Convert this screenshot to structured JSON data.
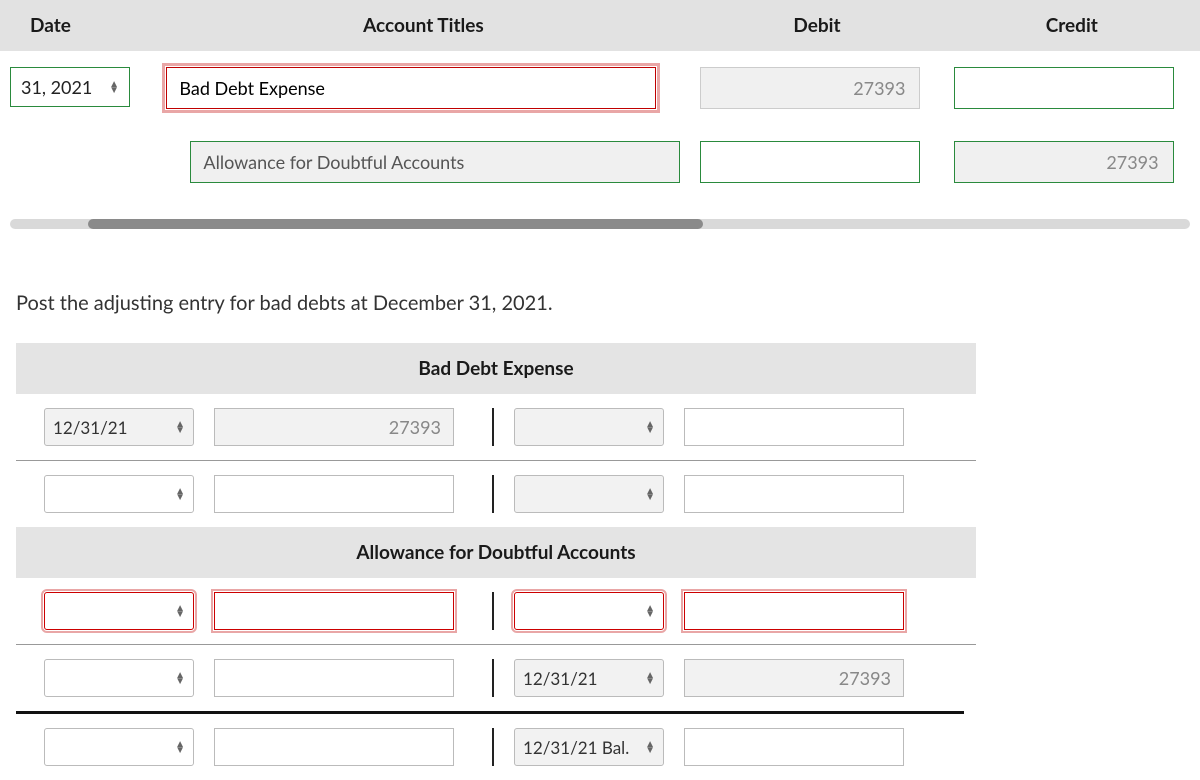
{
  "journal": {
    "headers": {
      "date": "Date",
      "titles": "Account Titles",
      "debit": "Debit",
      "credit": "Credit"
    },
    "rows": [
      {
        "date": "31, 2021",
        "account": "Bad Debt Expense",
        "debit": "27393",
        "credit": ""
      },
      {
        "date": "",
        "account": "Allowance for Doubtful Accounts",
        "debit": "",
        "credit": "27393"
      }
    ]
  },
  "instruction": "Post the adjusting entry for bad debts at December 31, 2021.",
  "taccounts": [
    {
      "title": "Bad Debt Expense",
      "rows": [
        {
          "left_date": "12/31/21",
          "left_amount": "27393",
          "right_date": "",
          "right_amount": ""
        },
        {
          "left_date": "",
          "left_amount": "",
          "right_date": "",
          "right_amount": ""
        }
      ]
    },
    {
      "title": "Allowance for Doubtful Accounts",
      "rows": [
        {
          "left_date": "",
          "left_amount": "",
          "right_date": "",
          "right_amount": "",
          "highlight": true
        },
        {
          "left_date": "",
          "left_amount": "",
          "right_date": "12/31/21",
          "right_amount": "27393"
        },
        {
          "left_date": "",
          "left_amount": "",
          "right_date": "12/31/21 Bal.",
          "right_amount": "",
          "balance": true
        }
      ]
    }
  ]
}
